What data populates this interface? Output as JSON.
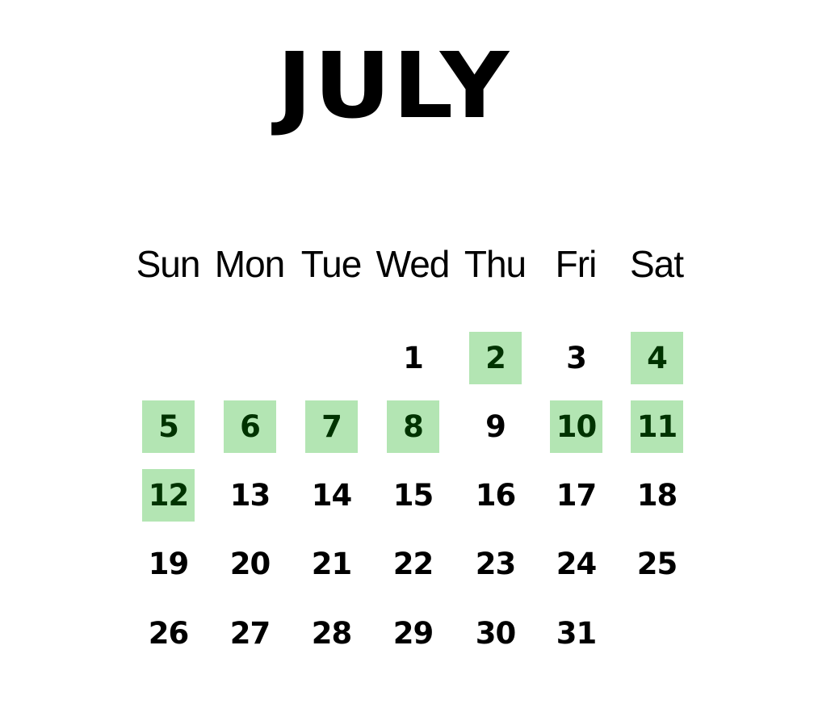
{
  "title": "JULY",
  "weekdays": [
    "Sun",
    "Mon",
    "Tue",
    "Wed",
    "Thu",
    "Fri",
    "Sat"
  ],
  "weeks": [
    [
      null,
      null,
      null,
      1,
      2,
      3,
      4
    ],
    [
      5,
      6,
      7,
      8,
      9,
      10,
      11
    ],
    [
      12,
      13,
      14,
      15,
      16,
      17,
      18
    ],
    [
      19,
      20,
      21,
      22,
      23,
      24,
      25
    ],
    [
      26,
      27,
      28,
      29,
      30,
      31,
      null
    ]
  ],
  "highlighted_days": [
    2,
    4,
    5,
    6,
    7,
    8,
    10,
    11,
    12
  ],
  "colors": {
    "highlight_bg": "#b3e5b3",
    "highlight_text": "#003300",
    "text": "#000000"
  }
}
